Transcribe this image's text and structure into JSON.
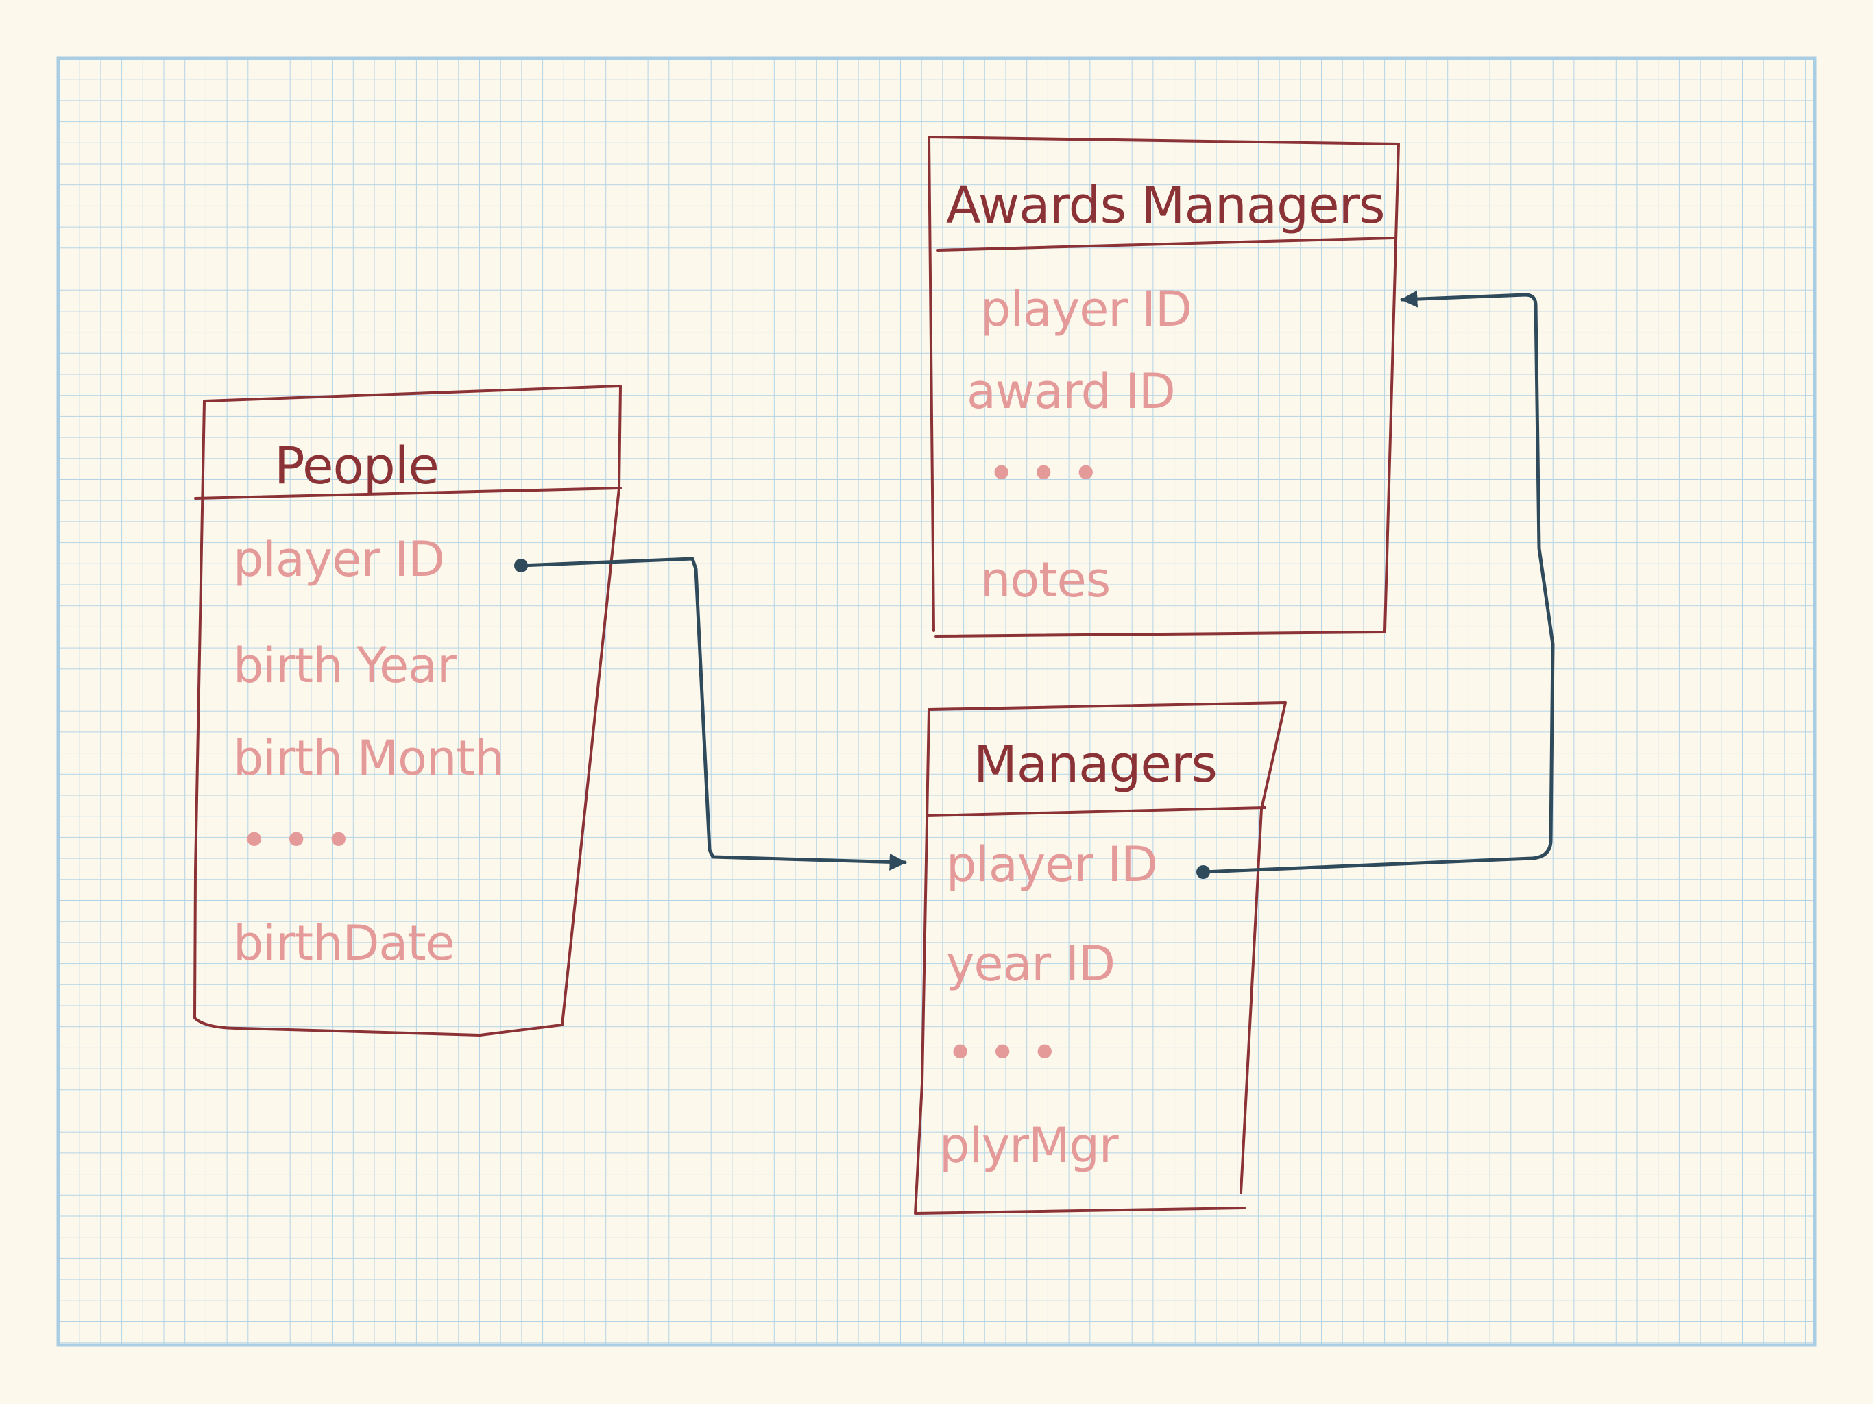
{
  "colors": {
    "background": "#fdf8ec",
    "grid": "#b3d4e6",
    "table_outline": "#8b3236",
    "title_text": "#8b3236",
    "field_text": "#e59a9a",
    "connector": "#2f4a5a"
  },
  "tables": [
    {
      "id": "people",
      "title": "People",
      "fields": [
        "player ID",
        "birth Year",
        "birth Month",
        "•  •  •",
        "birthDate"
      ]
    },
    {
      "id": "awards_managers",
      "title": "Awards Managers",
      "fields": [
        "player ID",
        "award ID",
        "•   •   •",
        "notes"
      ]
    },
    {
      "id": "managers",
      "title": "Managers",
      "fields": [
        "player ID",
        "year ID",
        "•  •  •",
        "plyrMgr"
      ]
    }
  ],
  "connectors": [
    {
      "from": "People.player ID",
      "to": "Managers.player ID",
      "end": "arrow"
    },
    {
      "from": "Managers.player ID",
      "to": "Awards Managers.player ID",
      "end": "arrow"
    }
  ]
}
